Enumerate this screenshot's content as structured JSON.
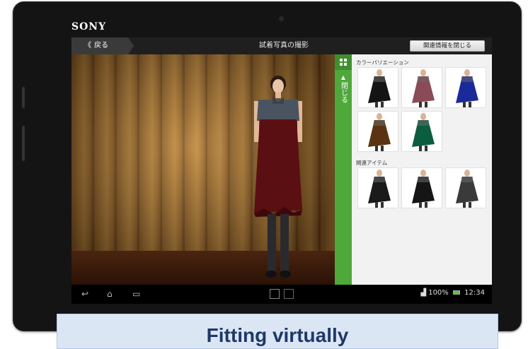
{
  "device": {
    "brand": "SONY"
  },
  "action_bar": {
    "back_label": "戻る",
    "title": "試着写真の撮影",
    "close_related_label": "関連情報を閉じる"
  },
  "side_tab": {
    "collapse_label": "閉じる"
  },
  "related_panel": {
    "color_variation_title": "カラーバリエーション",
    "color_variations": [
      {
        "color": "#141414",
        "icon": "dress-black-thumbnail"
      },
      {
        "color": "#8a4a58",
        "icon": "dress-mauve-thumbnail"
      },
      {
        "color": "#1a2a9a",
        "icon": "dress-blue-thumbnail"
      },
      {
        "color": "#5a3412",
        "icon": "dress-brown-thumbnail"
      },
      {
        "color": "#0a5e3e",
        "icon": "dress-green-thumbnail"
      }
    ],
    "related_items_title": "関連アイテム",
    "related_items": [
      {
        "color": "#1a1a1a",
        "icon": "black-sheath-dress-thumbnail"
      },
      {
        "color": "#151515",
        "icon": "black-tunic-thumbnail"
      },
      {
        "color": "#3a3a3a",
        "icon": "patterned-dress-thumbnail"
      }
    ]
  },
  "status_bar": {
    "battery": "100%",
    "time": "12:34"
  },
  "caption": "Fitting virtually",
  "colors": {
    "accent_green": "#4ea83a",
    "dress": "#5a0f12",
    "caption_text": "#1f3868"
  }
}
